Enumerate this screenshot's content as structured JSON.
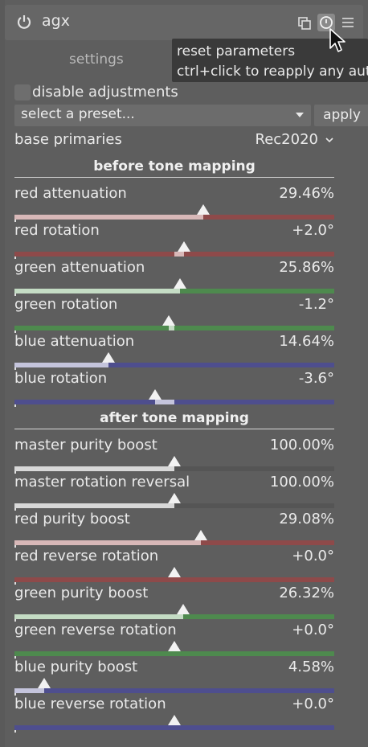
{
  "header": {
    "module_name": "agx"
  },
  "tabs": {
    "settings_label": "settings"
  },
  "tooltip": {
    "line1": "reset parameters",
    "line2": "ctrl+click to reapply any aut"
  },
  "disable_adjustments": {
    "label": "disable adjustments",
    "checked": false
  },
  "preset": {
    "placeholder": "select a preset...",
    "apply_label": "apply"
  },
  "base_primaries": {
    "label": "base primaries",
    "value": "Rec2020"
  },
  "sections": {
    "before": "before tone mapping",
    "after": "after tone mapping"
  },
  "sliders_before": [
    {
      "label": "red attenuation",
      "value": "29.46%",
      "position": 0.59,
      "mode": "left",
      "track": "#8e4a4a",
      "fill": "#d8b8b8"
    },
    {
      "label": "red rotation",
      "value": "+2.0°",
      "position": 0.53,
      "mode": "center",
      "track": "#8e4a4a",
      "fill": "#d8b8b8"
    },
    {
      "label": "green attenuation",
      "value": "25.86%",
      "position": 0.518,
      "mode": "left",
      "track": "#4e8a4e",
      "fill": "#c4dcc4"
    },
    {
      "label": "green rotation",
      "value": "-1.2°",
      "position": 0.482,
      "mode": "center",
      "track": "#4e8a4e",
      "fill": "#c4dcc4"
    },
    {
      "label": "blue attenuation",
      "value": "14.64%",
      "position": 0.293,
      "mode": "left",
      "track": "#4e4e8e",
      "fill": "#c4c4dc"
    },
    {
      "label": "blue rotation",
      "value": "-3.6°",
      "position": 0.44,
      "mode": "center",
      "track": "#4e4e8e",
      "fill": "#c4c4dc"
    }
  ],
  "sliders_after": [
    {
      "label": "master purity boost",
      "value": "100.00%",
      "position": 0.5,
      "mode": "left",
      "track": "#555555",
      "fill": "#d8d8d8"
    },
    {
      "label": "master rotation reversal",
      "value": "100.00%",
      "position": 0.5,
      "mode": "left",
      "track": "#555555",
      "fill": "#d8d8d8"
    },
    {
      "label": "red purity boost",
      "value": "29.08%",
      "position": 0.582,
      "mode": "left",
      "track": "#8e4a4a",
      "fill": "#d8b8b8"
    },
    {
      "label": "red reverse rotation",
      "value": "+0.0°",
      "position": 0.5,
      "mode": "center",
      "track": "#8e4a4a",
      "fill": "#d8b8b8"
    },
    {
      "label": "green purity boost",
      "value": "26.32%",
      "position": 0.527,
      "mode": "left",
      "track": "#4e8a4e",
      "fill": "#c4dcc4"
    },
    {
      "label": "green reverse rotation",
      "value": "+0.0°",
      "position": 0.5,
      "mode": "center",
      "track": "#4e8a4e",
      "fill": "#c4dcc4"
    },
    {
      "label": "blue purity boost",
      "value": "4.58%",
      "position": 0.092,
      "mode": "left",
      "track": "#4e4e8e",
      "fill": "#c4c4dc"
    },
    {
      "label": "blue reverse rotation",
      "value": "+0.0°",
      "position": 0.5,
      "mode": "center",
      "track": "#4e4e8e",
      "fill": "#c4c4dc"
    }
  ],
  "icons": {
    "power": "power-icon",
    "multi_instance": "multi-instance-icon",
    "reset": "reset-icon",
    "presets_menu": "hamburger-menu-icon",
    "combo_arrow": "chevron-down-icon",
    "cursor": "mouse-pointer-icon"
  }
}
